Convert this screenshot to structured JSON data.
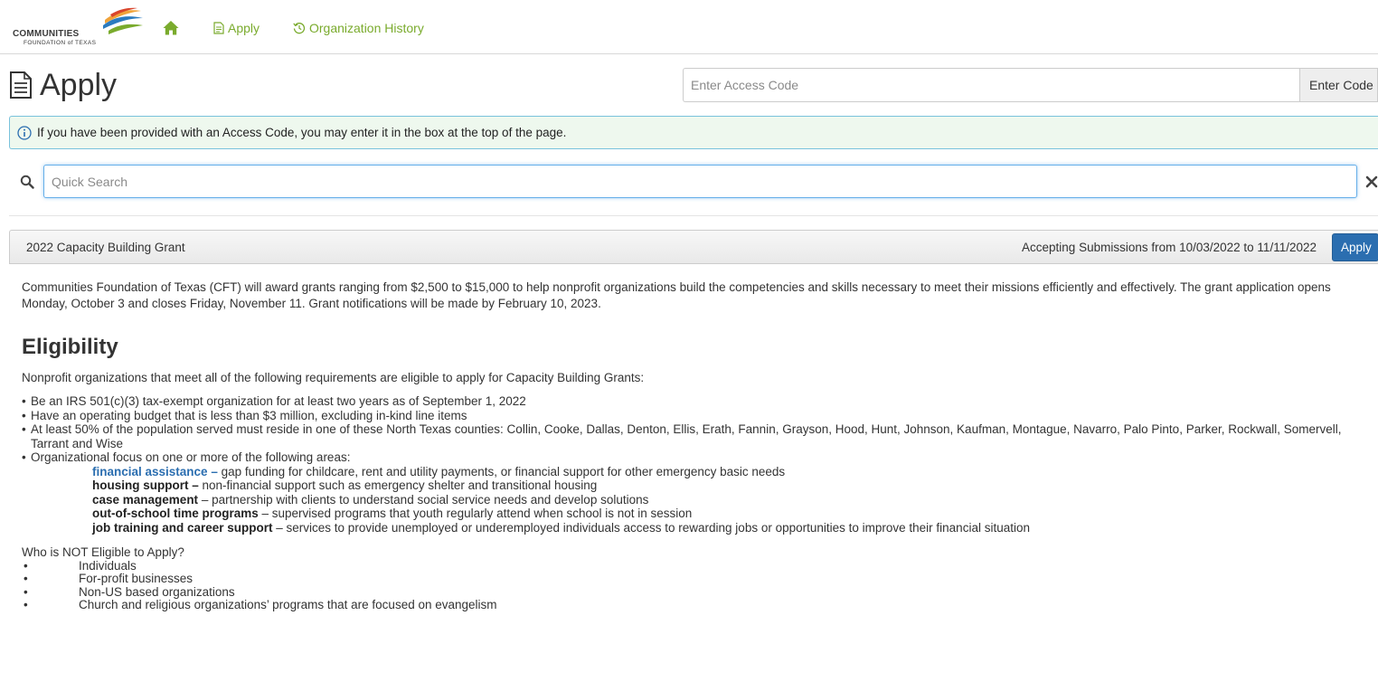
{
  "brand": {
    "logo_word": "COMMUNITIES",
    "logo_sub": "FOUNDATION of TEXAS",
    "accent_green": "#7aab2d",
    "primary_blue": "#2b6eb0"
  },
  "nav": {
    "home_icon": "home-icon",
    "apply_label": "Apply",
    "history_label": "Organization History"
  },
  "page": {
    "title": "Apply",
    "access_code_placeholder": "Enter Access Code",
    "access_code_button": "Enter Code"
  },
  "alert": {
    "icon": "info-icon",
    "text": "If you have been provided with an Access Code, you may enter it in the box at the top of the page."
  },
  "search": {
    "placeholder": "Quick Search",
    "icon": "search-icon",
    "clear_icon": "close-icon"
  },
  "grant": {
    "title": "2022 Capacity Building Grant",
    "dates": "Accepting Submissions from 10/03/2022 to 11/11/2022",
    "apply_label": "Apply",
    "intro": "Communities Foundation of Texas (CFT) will award grants ranging from $2,500 to $15,000 to help nonprofit organizations build the competencies and skills necessary to meet their missions efficiently and effectively. The grant application opens Monday, October 3 and closes Friday, November 11. Grant notifications will be made by February 10, 2023.",
    "eligibility_heading": "Eligibility",
    "eligibility_lead": "Nonprofit organizations that meet all of the following requirements are eligible to apply for Capacity Building Grants:",
    "requirements": [
      "Be an IRS 501(c)(3) tax-exempt organization for at least two years as of September 1, 2022",
      "Have an operating budget that is less than $3 million, excluding in-kind line items",
      "At least 50% of the population served must reside in one of these North Texas counties: Collin, Cooke, Dallas, Denton, Ellis, Erath, Fannin, Grayson, Hood, Hunt, Johnson, Kaufman, Montague, Navarro, Palo Pinto, Parker, Rockwall, Somervell, Tarrant and Wise",
      "Organizational focus on one or more of the following areas:"
    ],
    "focus_areas": [
      {
        "term": "financial assistance –",
        "desc": " gap funding for childcare, rent and utility payments, or financial support for other emergency basic needs"
      },
      {
        "term": "housing support –",
        "desc": " non-financial support such as emergency shelter and transitional housing"
      },
      {
        "term": "case management",
        "desc": " – partnership with clients to understand social service needs and develop solutions"
      },
      {
        "term": "out-of-school time programs",
        "desc": " – supervised programs that youth regularly attend when school is not in session"
      },
      {
        "term": "job training and career support",
        "desc": " – services to provide unemployed or underemployed individuals access to rewarding jobs or opportunities to improve their financial situation"
      }
    ],
    "not_eligible_title": "Who is NOT Eligible to Apply?",
    "not_eligible": [
      "Individuals",
      "For-profit businesses",
      "Non-US based organizations",
      "Church and religious organizations’ programs that are focused on evangelism"
    ]
  }
}
